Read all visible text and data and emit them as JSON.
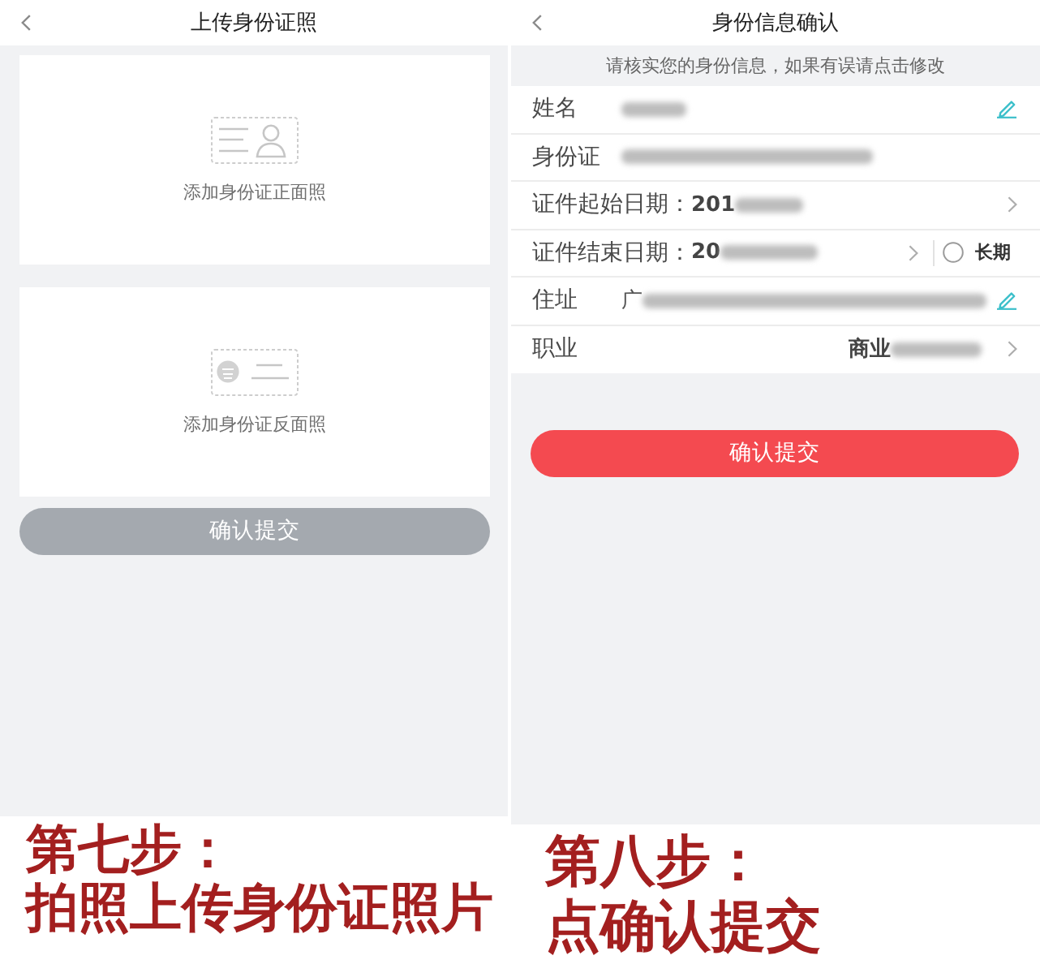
{
  "screens": [
    {
      "kind": "upload",
      "title": "上传身份证照",
      "cards": [
        {
          "kind": "front",
          "label": "添加身份证正面照"
        },
        {
          "kind": "back",
          "label": "添加身份证反面照"
        }
      ],
      "submit": {
        "label": "确认提交",
        "disabled": true
      }
    },
    {
      "kind": "confirm",
      "title": "身份信息确认",
      "notice": "请核实您的身份信息，如果有误请点击修改",
      "fields": [
        {
          "kind": "text",
          "label": "姓名",
          "blurred": true,
          "editable": true,
          "navigable": false
        },
        {
          "kind": "text",
          "label": "身份证",
          "blurred": true,
          "editable": false,
          "navigable": false
        },
        {
          "kind": "date",
          "label": "证件起始日期：",
          "value": "201",
          "blurred": true,
          "editable": false,
          "navigable": true
        },
        {
          "kind": "date",
          "label": "证件结束日期：",
          "value": "20",
          "blurred": true,
          "editable": false,
          "navigable": true,
          "option": {
            "label": "长期",
            "checked": false
          }
        },
        {
          "kind": "text",
          "label": "住址",
          "value": "广",
          "blurred": true,
          "editable": true,
          "navigable": false
        },
        {
          "kind": "select",
          "label": "职业",
          "value": "商业",
          "blurred": true,
          "editable": false,
          "navigable": true
        }
      ],
      "submit": {
        "label": "确认提交",
        "disabled": false
      }
    }
  ],
  "captions": [
    {
      "step": "第七步：",
      "text": "拍照上传身份证照片"
    },
    {
      "step": "第八步：",
      "text": "点确认提交"
    }
  ]
}
